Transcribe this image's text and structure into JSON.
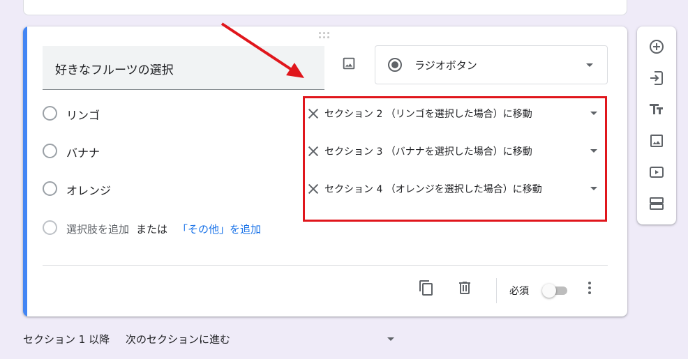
{
  "question": {
    "title": "好きなフルーツの選択",
    "type_label": "ラジオボタン",
    "options": [
      {
        "label": "リンゴ",
        "goto": "セクション 2 （リンゴを選択した場合）に移動"
      },
      {
        "label": "バナナ",
        "goto": "セクション 3 （バナナを選択した場合）に移動"
      },
      {
        "label": "オレンジ",
        "goto": "セクション 4 （オレンジを選択した場合）に移動"
      }
    ],
    "add_option": "選択肢を追加",
    "or_text": "または",
    "add_other": "「その他」を追加",
    "required_label": "必須",
    "required": false
  },
  "after_section": {
    "label": "セクション 1 以降",
    "value": "次のセクションに進む"
  },
  "side_toolbar": [
    "add-question-icon",
    "import-questions-icon",
    "add-title-icon",
    "add-image-icon",
    "add-video-icon",
    "add-section-icon"
  ],
  "colors": {
    "accent": "#4285f4",
    "highlight": "#e0161c",
    "link": "#1a73e8",
    "background": "#efebf8"
  }
}
